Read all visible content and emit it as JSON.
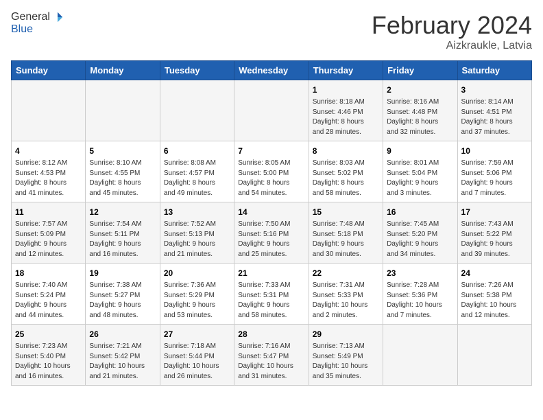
{
  "header": {
    "logo_general": "General",
    "logo_blue": "Blue",
    "month_year": "February 2024",
    "location": "Aizkraukle, Latvia"
  },
  "days_of_week": [
    "Sunday",
    "Monday",
    "Tuesday",
    "Wednesday",
    "Thursday",
    "Friday",
    "Saturday"
  ],
  "weeks": [
    [
      {
        "day": "",
        "info": ""
      },
      {
        "day": "",
        "info": ""
      },
      {
        "day": "",
        "info": ""
      },
      {
        "day": "",
        "info": ""
      },
      {
        "day": "1",
        "info": "Sunrise: 8:18 AM\nSunset: 4:46 PM\nDaylight: 8 hours\nand 28 minutes."
      },
      {
        "day": "2",
        "info": "Sunrise: 8:16 AM\nSunset: 4:48 PM\nDaylight: 8 hours\nand 32 minutes."
      },
      {
        "day": "3",
        "info": "Sunrise: 8:14 AM\nSunset: 4:51 PM\nDaylight: 8 hours\nand 37 minutes."
      }
    ],
    [
      {
        "day": "4",
        "info": "Sunrise: 8:12 AM\nSunset: 4:53 PM\nDaylight: 8 hours\nand 41 minutes."
      },
      {
        "day": "5",
        "info": "Sunrise: 8:10 AM\nSunset: 4:55 PM\nDaylight: 8 hours\nand 45 minutes."
      },
      {
        "day": "6",
        "info": "Sunrise: 8:08 AM\nSunset: 4:57 PM\nDaylight: 8 hours\nand 49 minutes."
      },
      {
        "day": "7",
        "info": "Sunrise: 8:05 AM\nSunset: 5:00 PM\nDaylight: 8 hours\nand 54 minutes."
      },
      {
        "day": "8",
        "info": "Sunrise: 8:03 AM\nSunset: 5:02 PM\nDaylight: 8 hours\nand 58 minutes."
      },
      {
        "day": "9",
        "info": "Sunrise: 8:01 AM\nSunset: 5:04 PM\nDaylight: 9 hours\nand 3 minutes."
      },
      {
        "day": "10",
        "info": "Sunrise: 7:59 AM\nSunset: 5:06 PM\nDaylight: 9 hours\nand 7 minutes."
      }
    ],
    [
      {
        "day": "11",
        "info": "Sunrise: 7:57 AM\nSunset: 5:09 PM\nDaylight: 9 hours\nand 12 minutes."
      },
      {
        "day": "12",
        "info": "Sunrise: 7:54 AM\nSunset: 5:11 PM\nDaylight: 9 hours\nand 16 minutes."
      },
      {
        "day": "13",
        "info": "Sunrise: 7:52 AM\nSunset: 5:13 PM\nDaylight: 9 hours\nand 21 minutes."
      },
      {
        "day": "14",
        "info": "Sunrise: 7:50 AM\nSunset: 5:16 PM\nDaylight: 9 hours\nand 25 minutes."
      },
      {
        "day": "15",
        "info": "Sunrise: 7:48 AM\nSunset: 5:18 PM\nDaylight: 9 hours\nand 30 minutes."
      },
      {
        "day": "16",
        "info": "Sunrise: 7:45 AM\nSunset: 5:20 PM\nDaylight: 9 hours\nand 34 minutes."
      },
      {
        "day": "17",
        "info": "Sunrise: 7:43 AM\nSunset: 5:22 PM\nDaylight: 9 hours\nand 39 minutes."
      }
    ],
    [
      {
        "day": "18",
        "info": "Sunrise: 7:40 AM\nSunset: 5:24 PM\nDaylight: 9 hours\nand 44 minutes."
      },
      {
        "day": "19",
        "info": "Sunrise: 7:38 AM\nSunset: 5:27 PM\nDaylight: 9 hours\nand 48 minutes."
      },
      {
        "day": "20",
        "info": "Sunrise: 7:36 AM\nSunset: 5:29 PM\nDaylight: 9 hours\nand 53 minutes."
      },
      {
        "day": "21",
        "info": "Sunrise: 7:33 AM\nSunset: 5:31 PM\nDaylight: 9 hours\nand 58 minutes."
      },
      {
        "day": "22",
        "info": "Sunrise: 7:31 AM\nSunset: 5:33 PM\nDaylight: 10 hours\nand 2 minutes."
      },
      {
        "day": "23",
        "info": "Sunrise: 7:28 AM\nSunset: 5:36 PM\nDaylight: 10 hours\nand 7 minutes."
      },
      {
        "day": "24",
        "info": "Sunrise: 7:26 AM\nSunset: 5:38 PM\nDaylight: 10 hours\nand 12 minutes."
      }
    ],
    [
      {
        "day": "25",
        "info": "Sunrise: 7:23 AM\nSunset: 5:40 PM\nDaylight: 10 hours\nand 16 minutes."
      },
      {
        "day": "26",
        "info": "Sunrise: 7:21 AM\nSunset: 5:42 PM\nDaylight: 10 hours\nand 21 minutes."
      },
      {
        "day": "27",
        "info": "Sunrise: 7:18 AM\nSunset: 5:44 PM\nDaylight: 10 hours\nand 26 minutes."
      },
      {
        "day": "28",
        "info": "Sunrise: 7:16 AM\nSunset: 5:47 PM\nDaylight: 10 hours\nand 31 minutes."
      },
      {
        "day": "29",
        "info": "Sunrise: 7:13 AM\nSunset: 5:49 PM\nDaylight: 10 hours\nand 35 minutes."
      },
      {
        "day": "",
        "info": ""
      },
      {
        "day": "",
        "info": ""
      }
    ]
  ]
}
